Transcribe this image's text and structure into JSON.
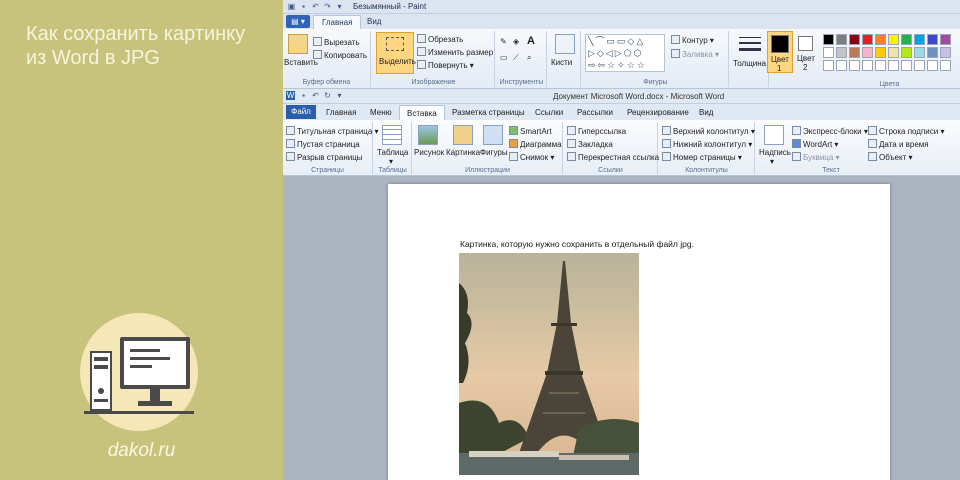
{
  "left_panel": {
    "title_line1": "Как сохранить картинку",
    "title_line2": "из Word в JPG",
    "site": "dakol.ru",
    "logo_icon": "computer-icon"
  },
  "paint": {
    "window_title": "Безымянный - Paint",
    "tabs": [
      "Главная",
      "Вид"
    ],
    "active_tab": "Главная",
    "clipboard": {
      "paste": "Вставить",
      "cut": "Вырезать",
      "copy": "Копировать",
      "label": "Буфер обмена"
    },
    "image": {
      "select": "Выделить",
      "crop": "Обрезать",
      "resize": "Изменить размер",
      "rotate": "Повернуть",
      "label": "Изображение"
    },
    "tools": {
      "label": "Инструменты"
    },
    "brushes": "Кисти",
    "shapes": {
      "outline": "Контур",
      "fill": "Заливка",
      "label": "Фигуры"
    },
    "thickness": "Толщина",
    "color1": {
      "label": "Цвет",
      "num": "1"
    },
    "color2": {
      "label": "Цвет",
      "num": "2"
    },
    "colors_label": "Цвета",
    "palette": [
      "#000000",
      "#7f7f7f",
      "#880015",
      "#ed1c24",
      "#ff7f27",
      "#fff200",
      "#22b14c",
      "#00a2e8",
      "#3f48cc",
      "#a349a4",
      "#ffffff",
      "#c3c3c3",
      "#b97a57",
      "#ffaec9",
      "#ffc90e",
      "#efe4b0",
      "#b5e61d",
      "#99d9ea",
      "#7092be",
      "#c8bfe7"
    ]
  },
  "word": {
    "window_title": "Документ Microsoft Word.docx - Microsoft Word",
    "file_tab": "Файл",
    "tabs": [
      "Главная",
      "Меню",
      "Вставка",
      "Разметка страницы",
      "Ссылки",
      "Рассылки",
      "Рецензирование",
      "Вид"
    ],
    "active_tab": "Вставка",
    "pages": {
      "cover": "Титульная страница",
      "blank": "Пустая страница",
      "break": "Разрыв страницы",
      "label": "Страницы"
    },
    "tables": {
      "table": "Таблица",
      "label": "Таблицы"
    },
    "illustrations": {
      "picture": "Рисунок",
      "clipart": "Картинка",
      "shapes": "Фигуры",
      "smartart": "SmartArt",
      "chart": "Диаграмма",
      "screenshot": "Снимок",
      "label": "Иллюстрации"
    },
    "links": {
      "hyperlink": "Гиперссылка",
      "bookmark": "Закладка",
      "crossref": "Перекрестная ссылка",
      "label": "Ссылки"
    },
    "header_footer": {
      "header": "Верхний колонтитул",
      "footer": "Нижний колонтитул",
      "page_number": "Номер страницы",
      "label": "Колонтитулы"
    },
    "text": {
      "textbox": "Надпись",
      "quickparts": "Экспресс-блоки",
      "wordart": "WordArt",
      "dropcap": "Буквица",
      "signature": "Строка подписи",
      "datetime": "Дата и время",
      "object": "Объект",
      "label": "Текст"
    },
    "document_text": "Картинка, которую нужно сохранить в отдельный файл jpg."
  }
}
